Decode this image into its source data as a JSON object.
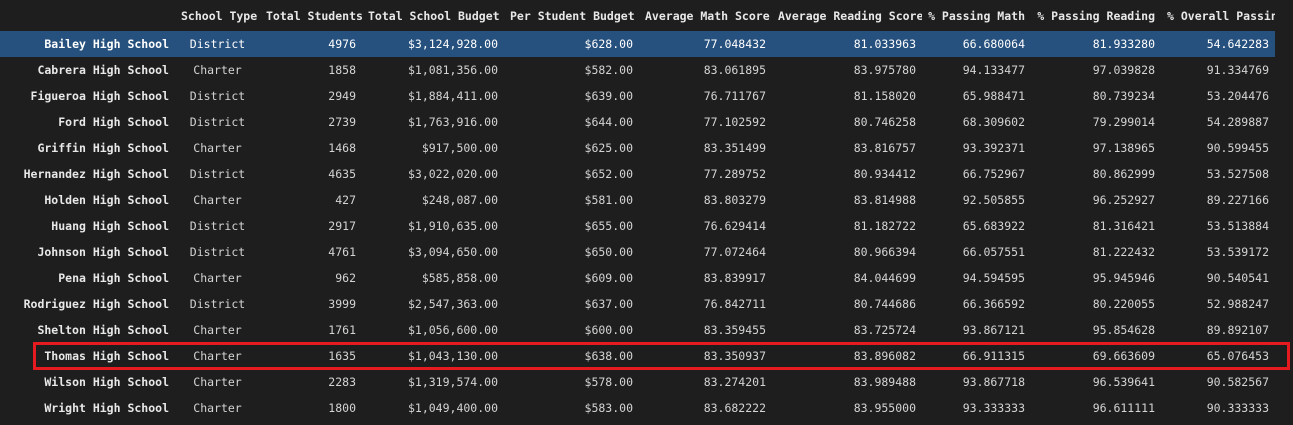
{
  "table": {
    "columns": [
      "School Type",
      "Total Students",
      "Total School Budget",
      "Per Student Budget",
      "Average Math Score",
      "Average Reading Score",
      "% Passing Math",
      "% Passing Reading",
      "% Overall Passing"
    ],
    "rows": [
      {
        "school": "Bailey High School",
        "cells": [
          "District",
          "4976",
          "$3,124,928.00",
          "$628.00",
          "77.048432",
          "81.033963",
          "66.680064",
          "81.933280",
          "54.642283"
        ]
      },
      {
        "school": "Cabrera High School",
        "cells": [
          "Charter",
          "1858",
          "$1,081,356.00",
          "$582.00",
          "83.061895",
          "83.975780",
          "94.133477",
          "97.039828",
          "91.334769"
        ]
      },
      {
        "school": "Figueroa High School",
        "cells": [
          "District",
          "2949",
          "$1,884,411.00",
          "$639.00",
          "76.711767",
          "81.158020",
          "65.988471",
          "80.739234",
          "53.204476"
        ]
      },
      {
        "school": "Ford High School",
        "cells": [
          "District",
          "2739",
          "$1,763,916.00",
          "$644.00",
          "77.102592",
          "80.746258",
          "68.309602",
          "79.299014",
          "54.289887"
        ]
      },
      {
        "school": "Griffin High School",
        "cells": [
          "Charter",
          "1468",
          "$917,500.00",
          "$625.00",
          "83.351499",
          "83.816757",
          "93.392371",
          "97.138965",
          "90.599455"
        ]
      },
      {
        "school": "Hernandez High School",
        "cells": [
          "District",
          "4635",
          "$3,022,020.00",
          "$652.00",
          "77.289752",
          "80.934412",
          "66.752967",
          "80.862999",
          "53.527508"
        ]
      },
      {
        "school": "Holden High School",
        "cells": [
          "Charter",
          "427",
          "$248,087.00",
          "$581.00",
          "83.803279",
          "83.814988",
          "92.505855",
          "96.252927",
          "89.227166"
        ]
      },
      {
        "school": "Huang High School",
        "cells": [
          "District",
          "2917",
          "$1,910,635.00",
          "$655.00",
          "76.629414",
          "81.182722",
          "65.683922",
          "81.316421",
          "53.513884"
        ]
      },
      {
        "school": "Johnson High School",
        "cells": [
          "District",
          "4761",
          "$3,094,650.00",
          "$650.00",
          "77.072464",
          "80.966394",
          "66.057551",
          "81.222432",
          "53.539172"
        ]
      },
      {
        "school": "Pena High School",
        "cells": [
          "Charter",
          "962",
          "$585,858.00",
          "$609.00",
          "83.839917",
          "84.044699",
          "94.594595",
          "95.945946",
          "90.540541"
        ]
      },
      {
        "school": "Rodriguez High School",
        "cells": [
          "District",
          "3999",
          "$2,547,363.00",
          "$637.00",
          "76.842711",
          "80.744686",
          "66.366592",
          "80.220055",
          "52.988247"
        ]
      },
      {
        "school": "Shelton High School",
        "cells": [
          "Charter",
          "1761",
          "$1,056,600.00",
          "$600.00",
          "83.359455",
          "83.725724",
          "93.867121",
          "95.854628",
          "89.892107"
        ]
      },
      {
        "school": "Thomas High School",
        "cells": [
          "Charter",
          "1635",
          "$1,043,130.00",
          "$638.00",
          "83.350937",
          "83.896082",
          "66.911315",
          "69.663609",
          "65.076453"
        ]
      },
      {
        "school": "Wilson High School",
        "cells": [
          "Charter",
          "2283",
          "$1,319,574.00",
          "$578.00",
          "83.274201",
          "83.989488",
          "93.867718",
          "96.539641",
          "90.582567"
        ]
      },
      {
        "school": "Wright High School",
        "cells": [
          "Charter",
          "1800",
          "$1,049,400.00",
          "$583.00",
          "83.682222",
          "83.955000",
          "93.333333",
          "96.611111",
          "90.333333"
        ]
      }
    ],
    "selected_row": 0,
    "highlighted_row": 12
  },
  "colors": {
    "background": "#1e1e1e",
    "selected_row": "#26507d",
    "highlight_border": "#e51b20"
  }
}
